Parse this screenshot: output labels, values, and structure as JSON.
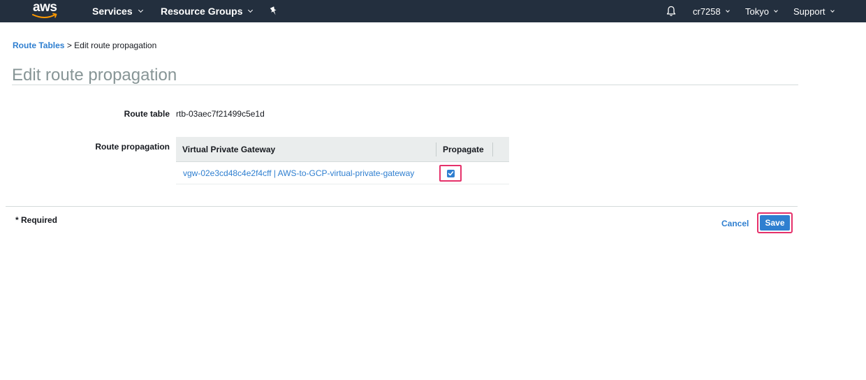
{
  "nav": {
    "logo_text": "aws",
    "services_label": "Services",
    "resource_groups_label": "Resource Groups",
    "account_label": "cr7258",
    "region_label": "Tokyo",
    "support_label": "Support",
    "icons": {
      "pin": "pin-icon",
      "bell": "bell-icon"
    }
  },
  "breadcrumb": {
    "parent_label": "Route Tables",
    "separator": ">",
    "current_label": "Edit route propagation"
  },
  "page": {
    "title": "Edit route propagation"
  },
  "form": {
    "route_table_label": "Route table",
    "route_table_value": "rtb-03aec7f21499c5e1d",
    "route_propagation_label": "Route propagation",
    "table": {
      "columns": [
        "Virtual Private Gateway",
        "Propagate"
      ],
      "rows": [
        {
          "gateway": "vgw-02e3cd48c4e2f4cff | AWS-to-GCP-virtual-private-gateway",
          "propagate": true
        }
      ]
    }
  },
  "footer": {
    "required_label": "* Required",
    "cancel_label": "Cancel",
    "save_label": "Save"
  },
  "colors": {
    "nav_bg": "#232f3e",
    "link": "#2f7fd0",
    "primary_button": "#2f7fd0",
    "highlight": "#e5316a"
  }
}
